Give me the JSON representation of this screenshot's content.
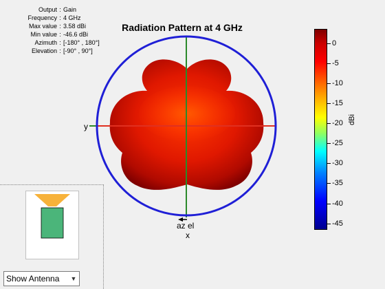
{
  "info_panel": [
    {
      "key": "Output",
      "value": "Gain"
    },
    {
      "key": "Frequency",
      "value": "4 GHz"
    },
    {
      "key": "Max value",
      "value": "3.58 dBi"
    },
    {
      "key": "Min value",
      "value": "-46.6 dBi"
    },
    {
      "key": "Azimuth",
      "value": "[-180° , 180°]"
    },
    {
      "key": "Elevation",
      "value": "[-90° , 90°]"
    }
  ],
  "separator": ":",
  "plot": {
    "title": "Radiation Pattern at 4 GHz",
    "axis_y_label": "y",
    "axis_x_label": "x",
    "az_label": "az",
    "el_label": "el"
  },
  "colorbar": {
    "unit": "dBi",
    "ticks": [
      "0",
      "-5",
      "-10",
      "-15",
      "-20",
      "-25",
      "-30",
      "-35",
      "-40",
      "-45"
    ],
    "max": 3.58,
    "min": -46.6
  },
  "controls": {
    "display_select": "Show Antenna"
  },
  "colors": {
    "circle": "#1f1fd6",
    "pattern": "#e02000",
    "x_axis": "#2a8a2a",
    "y_axis": "#e03020",
    "feed": "#f7b23a",
    "patch": "#4bb57a"
  },
  "icons": {
    "dropdown": "chevron-down-icon"
  }
}
